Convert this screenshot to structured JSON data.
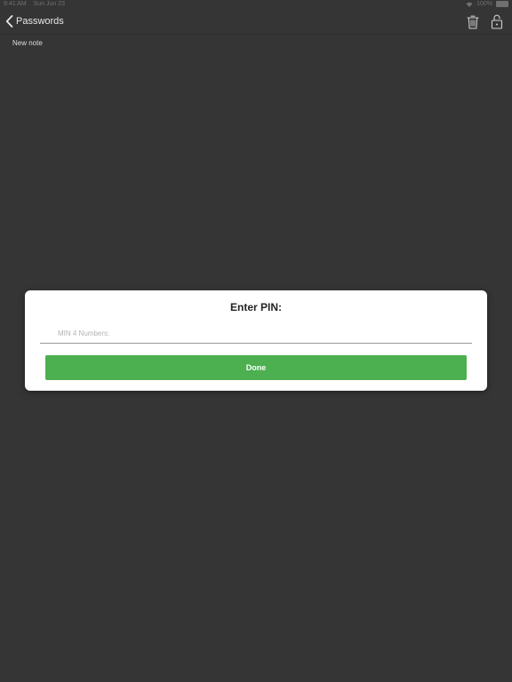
{
  "status_bar": {
    "time": "9:41 AM",
    "date": "Sun Jun 23",
    "battery_text": "100%",
    "battery_level": 1.0
  },
  "navbar": {
    "back_label": "Passwords",
    "back_icon": "chevron-left-icon",
    "trash_icon": "trash-icon",
    "lock_icon": "unlock-icon"
  },
  "note": {
    "title": "New note"
  },
  "pin_dialog": {
    "title": "Enter PIN:",
    "input_value": "",
    "input_placeholder": "MIN 4 Numbers:",
    "done_label": "Done"
  },
  "colors": {
    "background": "#353535",
    "accent": "#4caf50",
    "dialog_background": "#ffffff"
  }
}
